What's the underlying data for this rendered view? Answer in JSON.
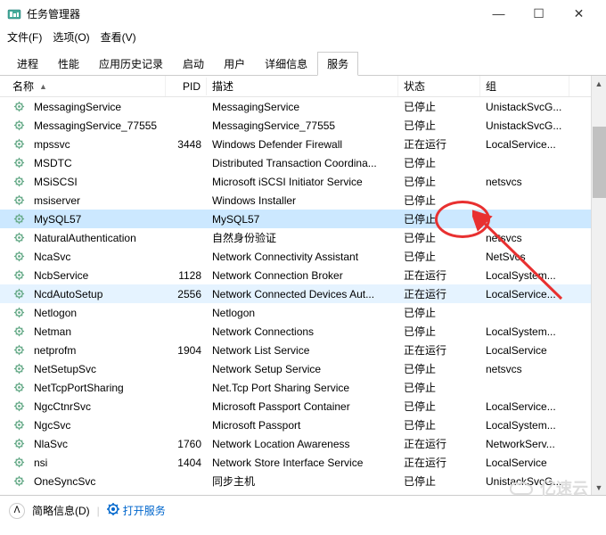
{
  "window": {
    "title": "任务管理器",
    "min": "—",
    "max": "☐",
    "close": "✕"
  },
  "menu": {
    "file": "文件(F)",
    "options": "选项(O)",
    "view": "查看(V)"
  },
  "tabs": {
    "items": [
      "进程",
      "性能",
      "应用历史记录",
      "启动",
      "用户",
      "详细信息",
      "服务"
    ],
    "active": 6
  },
  "columns": {
    "name": "名称",
    "pid": "PID",
    "desc": "描述",
    "state": "状态",
    "group": "组"
  },
  "rows": [
    {
      "name": "MessagingService",
      "pid": "",
      "desc": "MessagingService",
      "state": "已停止",
      "group": "UnistackSvcG..."
    },
    {
      "name": "MessagingService_77555",
      "pid": "",
      "desc": "MessagingService_77555",
      "state": "已停止",
      "group": "UnistackSvcG..."
    },
    {
      "name": "mpssvc",
      "pid": "3448",
      "desc": "Windows Defender Firewall",
      "state": "正在运行",
      "group": "LocalService..."
    },
    {
      "name": "MSDTC",
      "pid": "",
      "desc": "Distributed Transaction Coordina...",
      "state": "已停止",
      "group": ""
    },
    {
      "name": "MSiSCSI",
      "pid": "",
      "desc": "Microsoft iSCSI Initiator Service",
      "state": "已停止",
      "group": "netsvcs"
    },
    {
      "name": "msiserver",
      "pid": "",
      "desc": "Windows Installer",
      "state": "已停止",
      "group": ""
    },
    {
      "name": "MySQL57",
      "pid": "",
      "desc": "MySQL57",
      "state": "已停止",
      "group": "",
      "selected": true
    },
    {
      "name": "NaturalAuthentication",
      "pid": "",
      "desc": "自然身份验证",
      "state": "已停止",
      "group": "netsvcs"
    },
    {
      "name": "NcaSvc",
      "pid": "",
      "desc": "Network Connectivity Assistant",
      "state": "已停止",
      "group": "NetSvcs"
    },
    {
      "name": "NcbService",
      "pid": "1128",
      "desc": "Network Connection Broker",
      "state": "正在运行",
      "group": "LocalSystem..."
    },
    {
      "name": "NcdAutoSetup",
      "pid": "2556",
      "desc": "Network Connected Devices Aut...",
      "state": "正在运行",
      "group": "LocalService...",
      "hover": true
    },
    {
      "name": "Netlogon",
      "pid": "",
      "desc": "Netlogon",
      "state": "已停止",
      "group": ""
    },
    {
      "name": "Netman",
      "pid": "",
      "desc": "Network Connections",
      "state": "已停止",
      "group": "LocalSystem..."
    },
    {
      "name": "netprofm",
      "pid": "1904",
      "desc": "Network List Service",
      "state": "正在运行",
      "group": "LocalService"
    },
    {
      "name": "NetSetupSvc",
      "pid": "",
      "desc": "Network Setup Service",
      "state": "已停止",
      "group": "netsvcs"
    },
    {
      "name": "NetTcpPortSharing",
      "pid": "",
      "desc": "Net.Tcp Port Sharing Service",
      "state": "已停止",
      "group": ""
    },
    {
      "name": "NgcCtnrSvc",
      "pid": "",
      "desc": "Microsoft Passport Container",
      "state": "已停止",
      "group": "LocalService..."
    },
    {
      "name": "NgcSvc",
      "pid": "",
      "desc": "Microsoft Passport",
      "state": "已停止",
      "group": "LocalSystem..."
    },
    {
      "name": "NlaSvc",
      "pid": "1760",
      "desc": "Network Location Awareness",
      "state": "正在运行",
      "group": "NetworkServ..."
    },
    {
      "name": "nsi",
      "pid": "1404",
      "desc": "Network Store Interface Service",
      "state": "正在运行",
      "group": "LocalService"
    },
    {
      "name": "OneSyncSvc",
      "pid": "",
      "desc": "同步主机",
      "state": "已停止",
      "group": "UnistackSvcG..."
    }
  ],
  "footer": {
    "less": "简略信息(D)",
    "open": "打开服务"
  },
  "watermark": "亿速云"
}
